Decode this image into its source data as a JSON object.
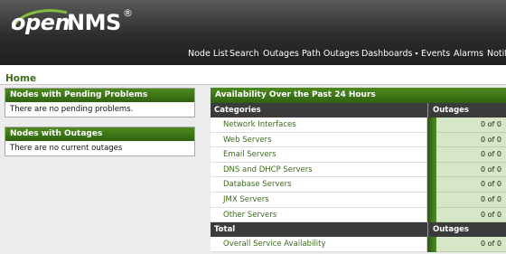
{
  "brand": {
    "open": "open",
    "nms": "NMS",
    "reg": "®"
  },
  "nav": {
    "items": [
      "Node List",
      "Search",
      "Outages",
      "Path Outages",
      "Dashboards",
      "Events",
      "Alarms",
      "Notifi"
    ],
    "dashboards_caret": "▾"
  },
  "page": {
    "title": "Home"
  },
  "pending": {
    "title": "Nodes with Pending Problems",
    "message": "There are no pending problems."
  },
  "outages_box": {
    "title": "Nodes with Outages",
    "message": "There are no current outages"
  },
  "availability": {
    "title": "Availability Over the Past 24 Hours",
    "col_categories": "Categories",
    "col_outages": "Outages",
    "rows": [
      {
        "label": "Network Interfaces",
        "value": "0 of 0"
      },
      {
        "label": "Web Servers",
        "value": "0 of 0"
      },
      {
        "label": "Email Servers",
        "value": "0 of 0"
      },
      {
        "label": "DNS and DHCP Servers",
        "value": "0 of 0"
      },
      {
        "label": "Database Servers",
        "value": "0 of 0"
      },
      {
        "label": "JMX Servers",
        "value": "0 of 0"
      },
      {
        "label": "Other Servers",
        "value": "0 of 0"
      }
    ],
    "total_label": "Total",
    "total_outages": "Outages",
    "total_rows": [
      {
        "label": "Overall Service Availability",
        "value": "0 of 0"
      }
    ]
  },
  "colors": {
    "accent_green": "#3d6b1e",
    "header_bar": "#2f6210",
    "value_bg": "#d7e6c6"
  }
}
